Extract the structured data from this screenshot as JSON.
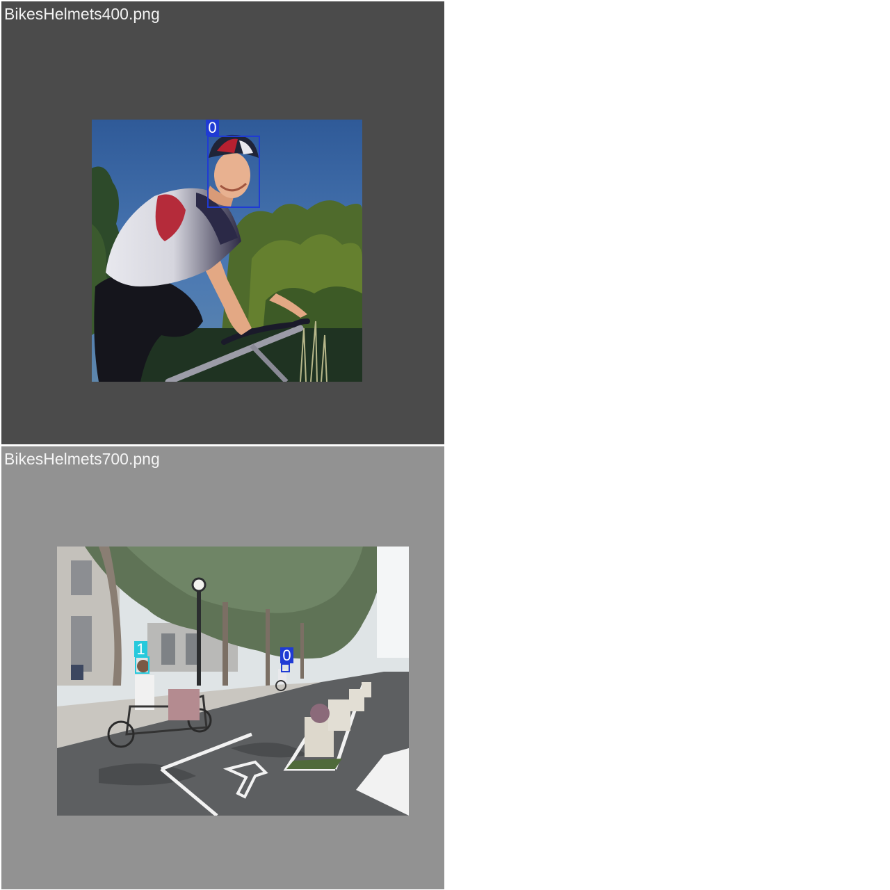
{
  "viewer": {
    "tiles": [
      {
        "filename": "BikesHelmets400.png",
        "background_color": "#4b4b4b",
        "title_color": "#f2f2f2",
        "image_subject": "cyclist wearing a helmet on a bike, trees and blue sky behind",
        "detections": [
          {
            "class_label": "0",
            "box_color": "#1f3bd4",
            "label_bg": "#1f3bd4",
            "label_text_color": "#ffffff"
          }
        ]
      },
      {
        "filename": "BikesHelmets700.png",
        "background_color": "#929292",
        "title_color": "#f5f5f5",
        "image_subject": "street bike lane with planters, trees and cyclists",
        "detections": [
          {
            "class_label": "1",
            "box_color": "#26c9dc",
            "label_bg": "#26c9dc",
            "label_text_color": "#ffffff"
          },
          {
            "class_label": "0",
            "box_color": "#1f3bd4",
            "label_bg": "#1f3bd4",
            "label_text_color": "#ffffff"
          }
        ]
      }
    ]
  }
}
